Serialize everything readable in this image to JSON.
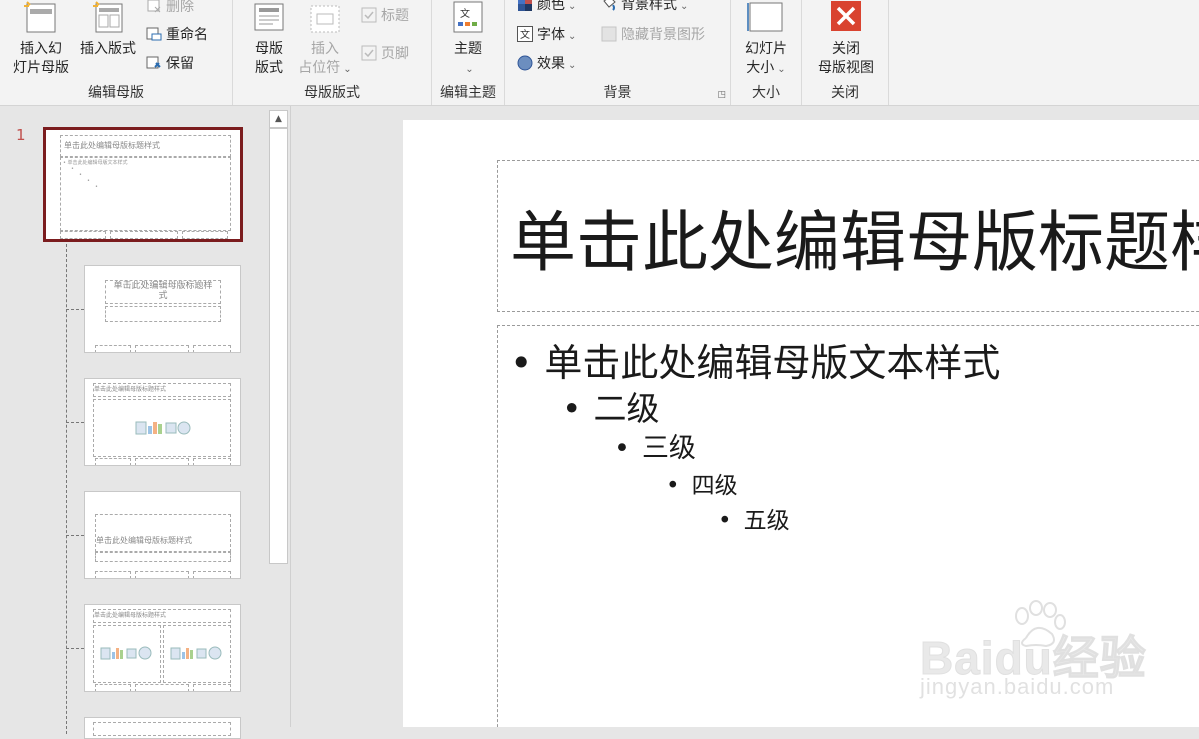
{
  "ribbon": {
    "edit_master": {
      "insert_slide_master": "插入幻\n灯片母版",
      "insert_layout": "插入版式",
      "delete": "删除",
      "rename": "重命名",
      "preserve": "保留",
      "group_label": "编辑母版"
    },
    "master_layout": {
      "master_layout_btn": "母版\n版式",
      "insert_placeholder": "插入\n占位符",
      "title_check": "标题",
      "footer_check": "页脚",
      "group_label": "母版版式"
    },
    "edit_theme": {
      "themes": "主题",
      "group_label": "编辑主题"
    },
    "background": {
      "colors": "颜色",
      "fonts": "字体",
      "effects": "效果",
      "background_styles": "背景样式",
      "hide_background_graphics": "隐藏背景图形",
      "group_label": "背景"
    },
    "size": {
      "slide_size": "幻灯片\n大小",
      "group_label": "大小"
    },
    "close": {
      "close_master_view": "关闭\n母版视图",
      "group_label": "关闭"
    }
  },
  "thumbnails": {
    "slide_number": "1",
    "master_title": "单击此处编辑母版标题样式",
    "master_text": "• 单击此处编辑母版文本样式",
    "layout_title_wrapped": "单击此处编辑母版标题样\n式"
  },
  "slide": {
    "title": "单击此处编辑母版标题样式",
    "levels": [
      "单击此处编辑母版文本样式",
      "二级",
      "三级",
      "四级",
      "五级"
    ]
  },
  "watermark": {
    "logo": "Baidu经验",
    "url": "jingyan.baidu.com"
  },
  "colors": {
    "accent": "#7b1c1e",
    "close_icon": "#d9432f",
    "slide_number": "#c0504d"
  }
}
